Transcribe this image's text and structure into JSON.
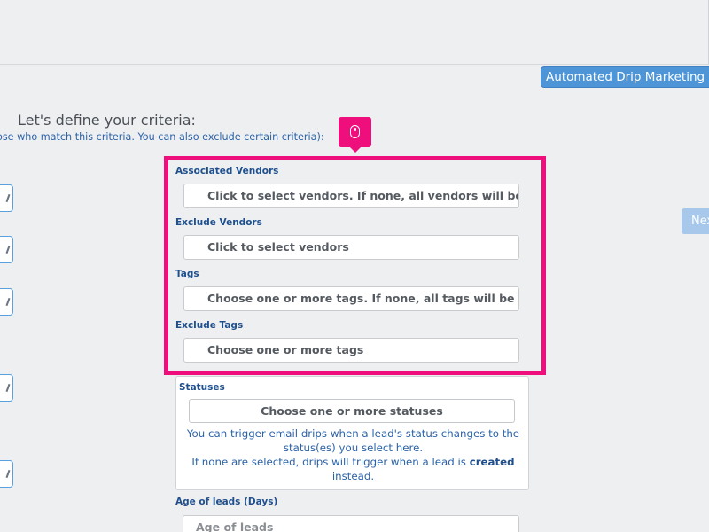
{
  "header": {
    "tab_label": "Automated Drip Marketing Em"
  },
  "intro": {
    "heading": "Let's define your criteria:",
    "subheading": "ose who match this criteria. You can also exclude certain criteria):"
  },
  "next_label": "Nex",
  "fields": {
    "associated_vendors": {
      "label": "Associated Vendors",
      "placeholder": "Click to select vendors. If none, all vendors will be sel"
    },
    "exclude_vendors": {
      "label": "Exclude Vendors",
      "placeholder": "Click to select vendors"
    },
    "tags": {
      "label": "Tags",
      "placeholder": "Choose one or more tags. If none, all tags will be sele"
    },
    "exclude_tags": {
      "label": "Exclude Tags",
      "placeholder": "Choose one or more tags"
    }
  },
  "statuses": {
    "label": "Statuses",
    "placeholder": "Choose one or more statuses",
    "help_line1": "You can trigger email drips when a lead's status changes to the",
    "help_line2": "status(es) you select here.",
    "help_line3_prefix": "If none are selected, drips will trigger when a lead is",
    "help_line3_bold": "created",
    "help_line4": "instead."
  },
  "age": {
    "label": "Age of leads (Days)",
    "placeholder": "Age of leads"
  },
  "colors": {
    "highlight": "#ee0f7c",
    "accent": "#4d95d6",
    "label_text": "#1f4f8c"
  }
}
